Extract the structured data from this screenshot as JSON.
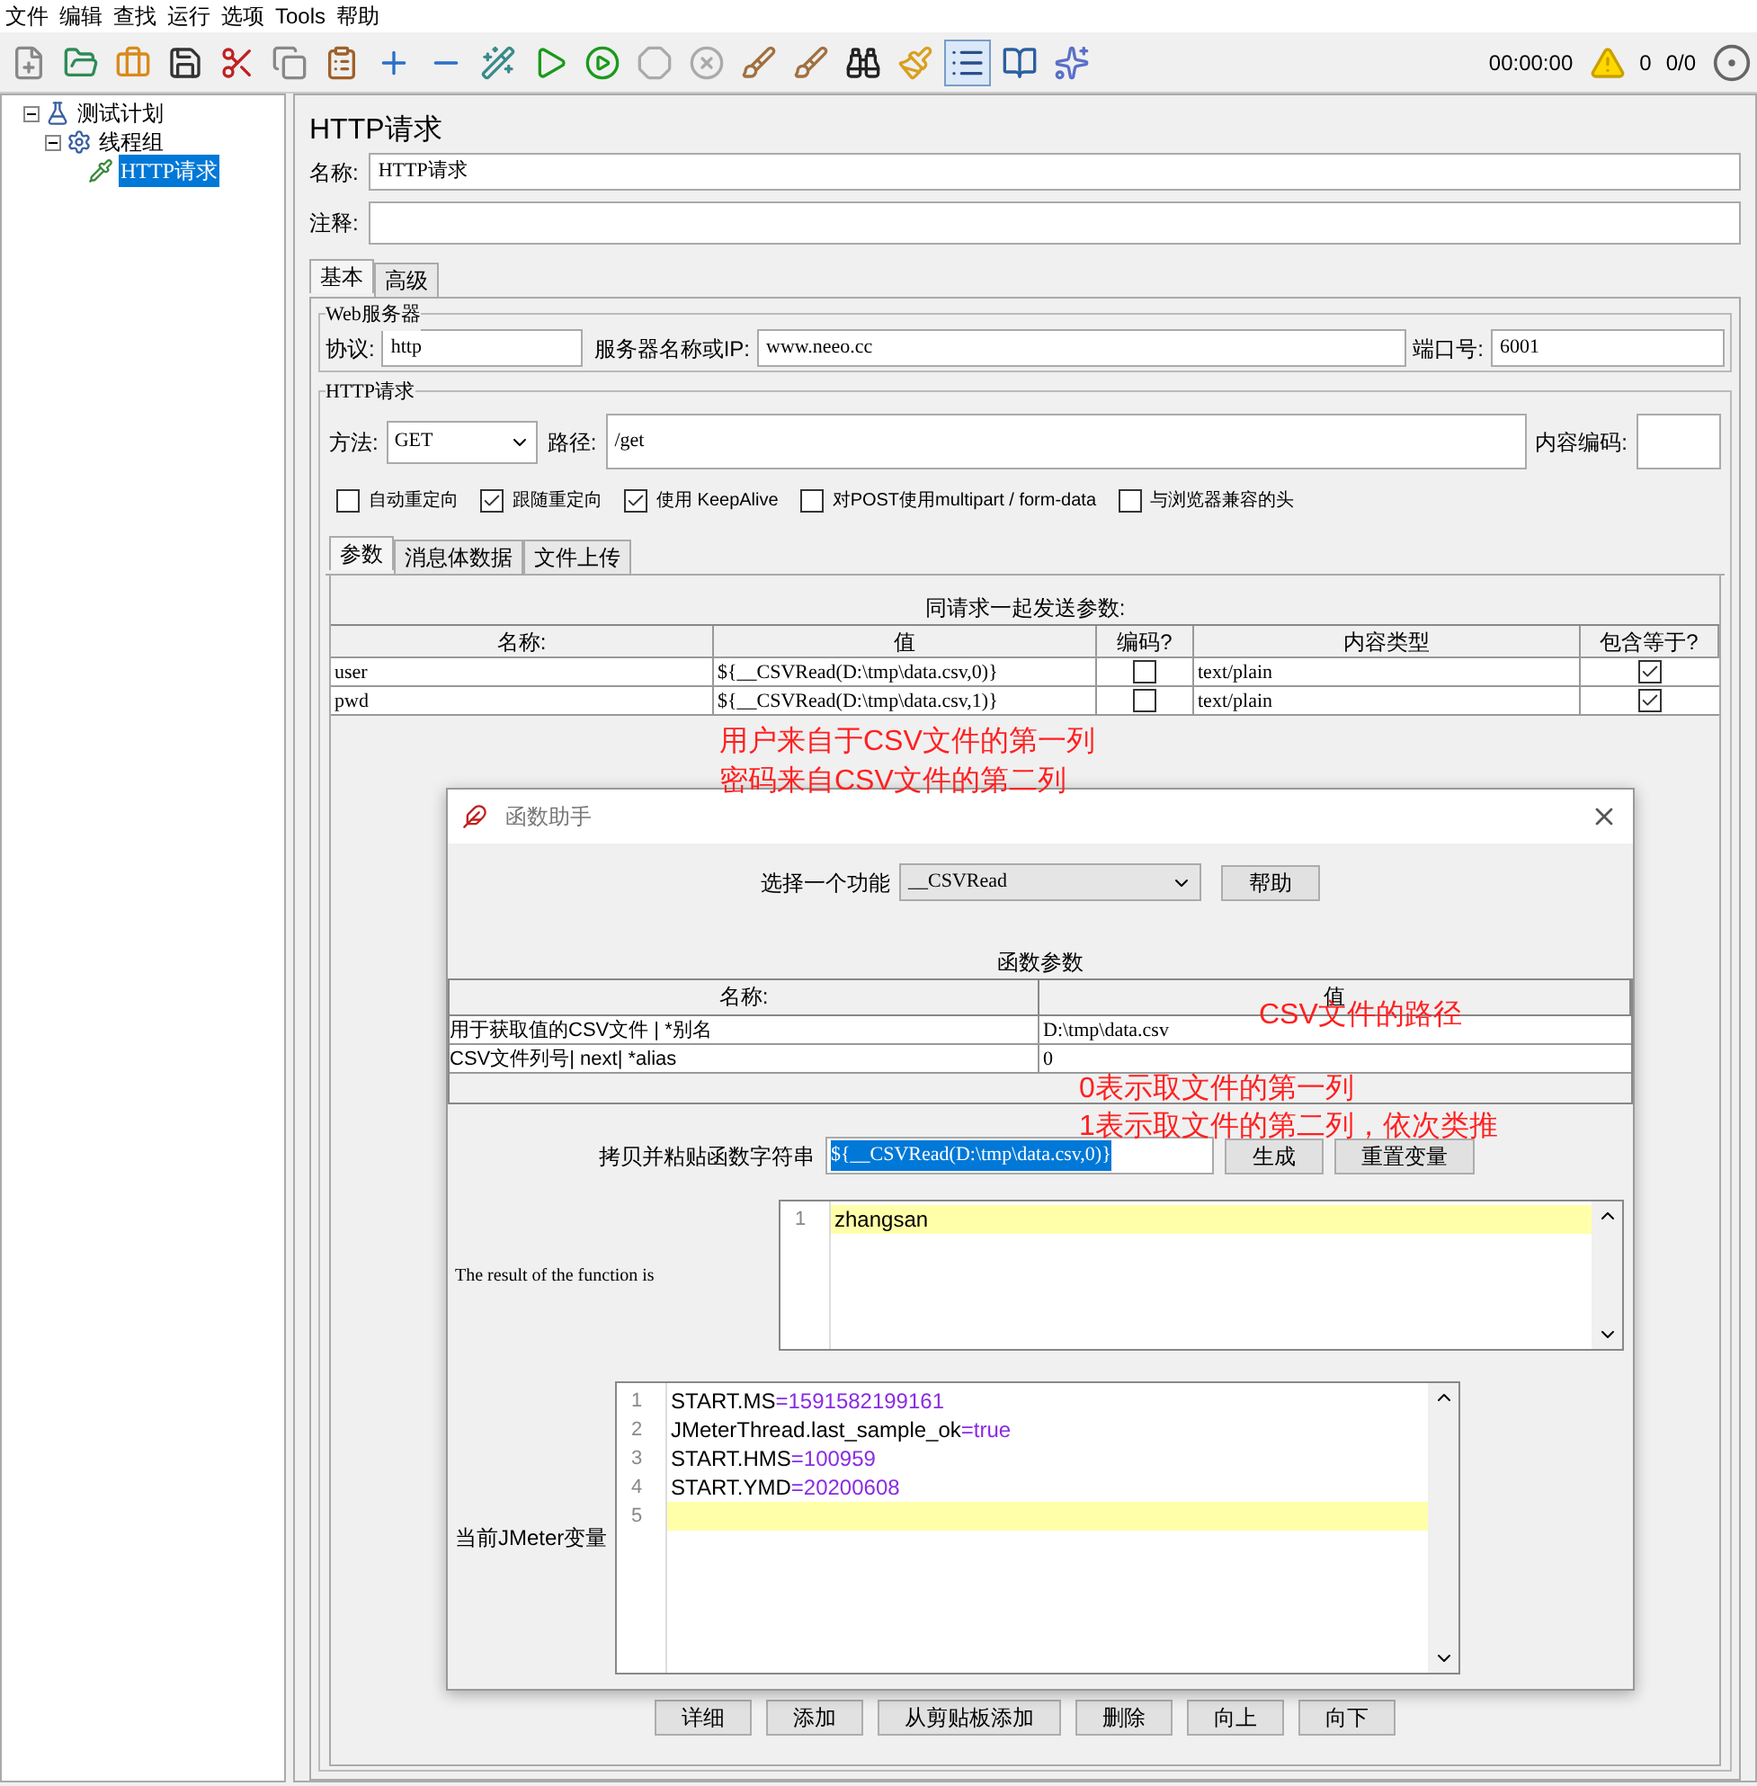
{
  "menu": [
    "文件",
    "编辑",
    "查找",
    "运行",
    "选项",
    "Tools",
    "帮助"
  ],
  "status": {
    "timer": "00:00:00",
    "warnings": "0",
    "threads": "0/0"
  },
  "tree": [
    {
      "label": "测试计划",
      "kind": "plan",
      "expanded": true,
      "selected": false,
      "children": [
        {
          "label": "线程组",
          "kind": "group",
          "expanded": true,
          "selected": false,
          "children": [
            {
              "label": "HTTP请求",
              "kind": "sampler",
              "selected": true
            }
          ]
        }
      ]
    }
  ],
  "panel": {
    "title": "HTTP请求",
    "name_label": "名称:",
    "name_value": "HTTP请求",
    "comment_label": "注释:",
    "tabs": [
      {
        "label": "基本",
        "selected": true
      },
      {
        "label": "高级",
        "selected": false
      }
    ],
    "web_server": {
      "legend": "Web服务器",
      "protocol_label": "协议:",
      "protocol": "http",
      "server_label": "服务器名称或IP:",
      "server": "www.neeo.cc",
      "port_label": "端口号:",
      "port": "6001"
    },
    "http_request": {
      "legend": "HTTP请求",
      "method_label": "方法:",
      "method": "GET",
      "path_label": "路径:",
      "path": "/get",
      "encoding_label": "内容编码:",
      "options": [
        {
          "label": "自动重定向",
          "checked": false
        },
        {
          "label": "跟随重定向",
          "checked": true
        },
        {
          "label": "使用 KeepAlive",
          "checked": true
        },
        {
          "label": "对POST使用multipart / form-data",
          "checked": false
        },
        {
          "label": "与浏览器兼容的头",
          "checked": false
        }
      ]
    },
    "sub_tabs": [
      {
        "label": "参数",
        "selected": true
      },
      {
        "label": "消息体数据",
        "selected": false
      },
      {
        "label": "文件上传",
        "selected": false
      }
    ],
    "params_title": "同请求一起发送参数:",
    "params_columns": [
      "名称:",
      "值",
      "编码?",
      "内容类型",
      "包含等于?"
    ],
    "params_rows": [
      {
        "name": "user",
        "value": "${__CSVRead(D:\\tmp\\data.csv,0)}",
        "encode": false,
        "content_type": "text/plain",
        "include_equals": true
      },
      {
        "name": "pwd",
        "value": "${__CSVRead(D:\\tmp\\data.csv,1)}",
        "encode": false,
        "content_type": "text/plain",
        "include_equals": true
      }
    ],
    "buttons": [
      "详细",
      "添加",
      "从剪贴板添加",
      "删除",
      "向上",
      "向下"
    ]
  },
  "dialog": {
    "title": "函数助手",
    "function_label": "选择一个功能",
    "function": "__CSVRead",
    "help_button": "帮助",
    "params_title": "函数参数",
    "columns": [
      "名称:",
      "值"
    ],
    "rows": [
      {
        "name": "用于获取值的CSV文件 | *别名",
        "value": "D:\\tmp\\data.csv"
      },
      {
        "name": "CSV文件列号| next| *alias",
        "value": "0"
      }
    ],
    "copy_label": "拷贝并粘贴函数字符串",
    "copy_value": "${__CSVRead(D:\\tmp\\data.csv,0)}",
    "generate_button": "生成",
    "reset_button": "重置变量",
    "result_label": "The result of the function is",
    "result_lines": [
      {
        "number": "1",
        "text": "zhangsan",
        "current": true
      }
    ],
    "vars_label": "当前JMeter变量",
    "vars_lines": [
      {
        "number": "1",
        "name": "START.MS",
        "value": "=1591582199161",
        "current": false
      },
      {
        "number": "2",
        "name": "JMeterThread.last_sample_ok",
        "value": "=true",
        "current": false
      },
      {
        "number": "3",
        "name": "START.HMS",
        "value": "=100959",
        "current": false
      },
      {
        "number": "4",
        "name": "START.YMD",
        "value": "=20200608",
        "current": false
      },
      {
        "number": "5",
        "current": true
      }
    ]
  },
  "annotations": [
    "用户来自于CSV文件的第一列",
    "密码来自CSV文件的第二列",
    "CSV文件的路径",
    "0表示取文件的第一列",
    "1表示取文件的第二列，依次类推"
  ]
}
